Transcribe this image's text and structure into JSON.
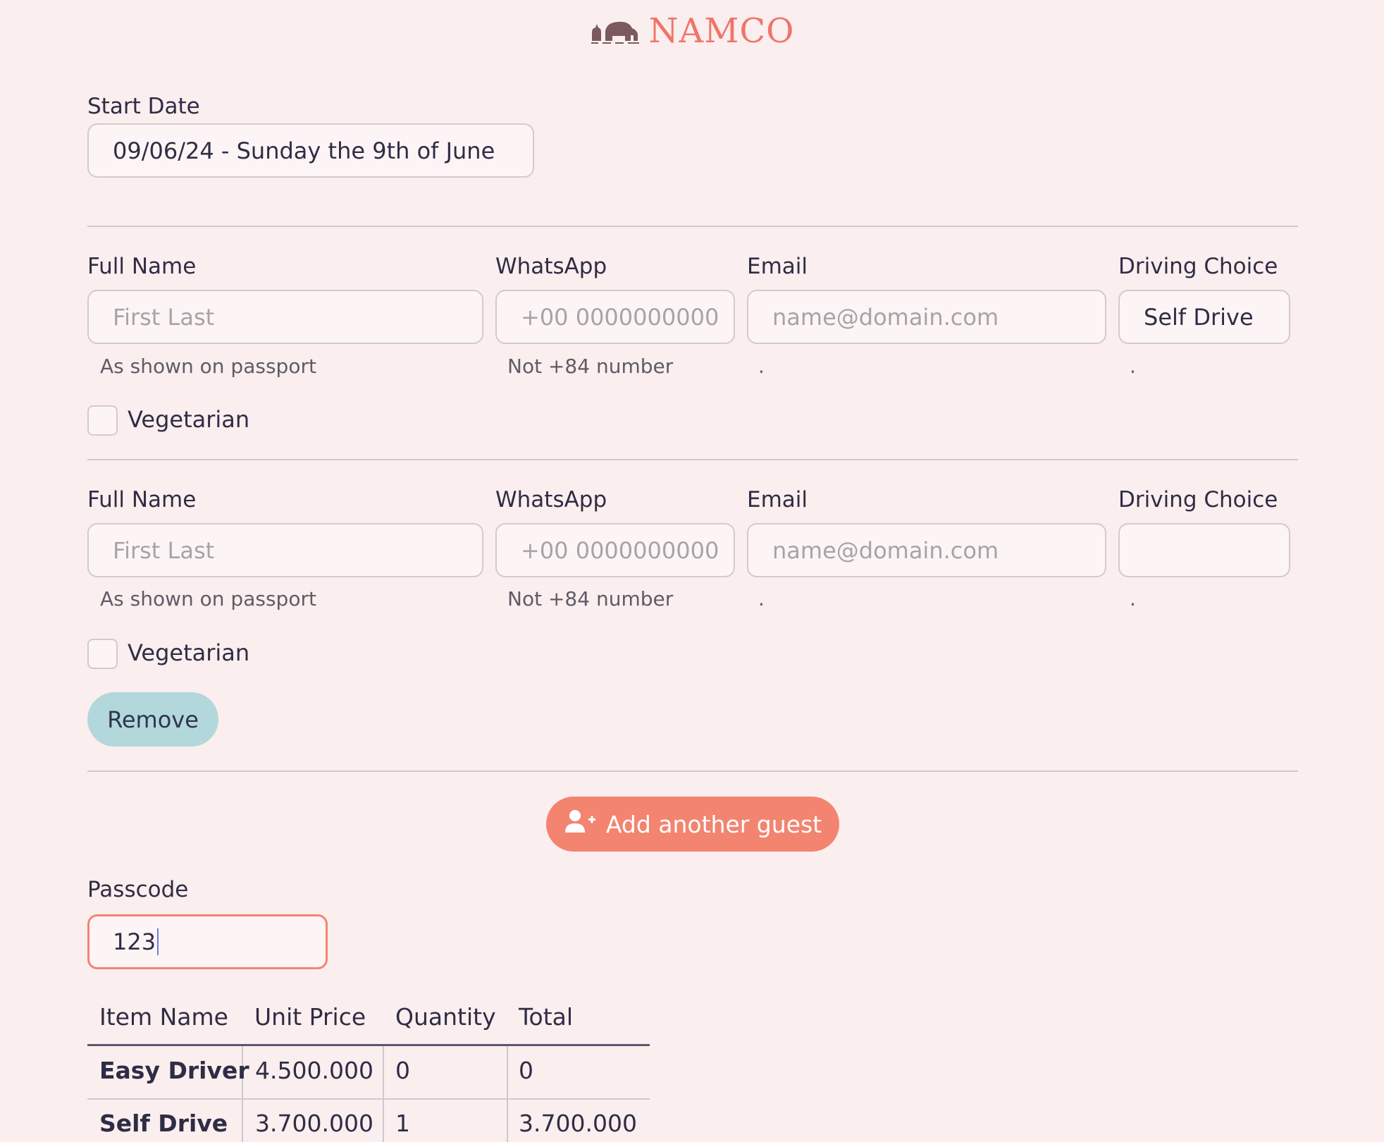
{
  "header": {
    "brand": "NAMCO",
    "logo_icon": "elephant-logo-icon"
  },
  "start_date": {
    "label": "Start Date",
    "value": "09/06/24 - Sunday the 9th of June"
  },
  "guests": [
    {
      "full_name": {
        "label": "Full Name",
        "value": "",
        "placeholder": "First Last",
        "hint": "As shown on passport"
      },
      "whatsapp": {
        "label": "WhatsApp",
        "value": "",
        "placeholder": "+00 0000000000",
        "hint": "Not +84 number"
      },
      "email": {
        "label": "Email",
        "value": "",
        "placeholder": "name@domain.com",
        "hint": "."
      },
      "driving_choice": {
        "label": "Driving Choice",
        "value": "Self Drive",
        "hint": "."
      },
      "vegetarian": {
        "label": "Vegetarian",
        "checked": false
      }
    },
    {
      "full_name": {
        "label": "Full Name",
        "value": "",
        "placeholder": "First Last",
        "hint": "As shown on passport"
      },
      "whatsapp": {
        "label": "WhatsApp",
        "value": "",
        "placeholder": "+00 0000000000",
        "hint": "Not +84 number"
      },
      "email": {
        "label": "Email",
        "value": "",
        "placeholder": "name@domain.com",
        "hint": "."
      },
      "driving_choice": {
        "label": "Driving Choice",
        "value": "",
        "hint": "."
      },
      "vegetarian": {
        "label": "Vegetarian",
        "checked": false
      },
      "remove_label": "Remove"
    }
  ],
  "add_guest": {
    "label": "Add another guest",
    "icon": "user-plus-icon"
  },
  "passcode": {
    "label": "Passcode",
    "value": "123"
  },
  "items_table": {
    "headers": [
      "Item Name",
      "Unit Price",
      "Quantity",
      "Total"
    ],
    "rows": [
      [
        "Easy Driver",
        "4.500.000",
        "0",
        "0"
      ],
      [
        "Self Drive",
        "3.700.000",
        "1",
        "3.700.000"
      ]
    ]
  },
  "colors": {
    "background": "#fbeeee",
    "brand": "#f0746a",
    "accent_button": "#f38470",
    "secondary_button": "#b2d8db",
    "text": "#2f2d45"
  }
}
